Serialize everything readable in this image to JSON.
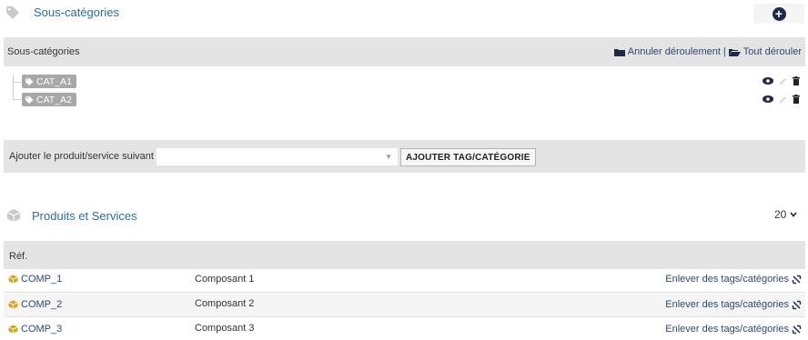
{
  "subcats": {
    "title": "Sous-catégories",
    "header_label": "Sous-catégories",
    "collapse_label": "Annuler déroulement",
    "separator": "|",
    "expand_label": "Tout dérouler",
    "items": [
      {
        "label": "CAT_A1"
      },
      {
        "label": "CAT_A2"
      }
    ]
  },
  "assign": {
    "label": "Ajouter le produit/service suivant",
    "select_value": "",
    "button_label": "AJOUTER TAG/CATÉGORIE"
  },
  "products": {
    "title": "Produits et Services",
    "page_size": "20",
    "header_ref": "Réf.",
    "rows": [
      {
        "ref": "COMP_1",
        "label": "Composant 1",
        "action": "Enlever des tags/catégories"
      },
      {
        "ref": "COMP_2",
        "label": "Composant 2",
        "action": "Enlever des tags/catégories"
      },
      {
        "ref": "COMP_3",
        "label": "Composant 3",
        "action": "Enlever des tags/catégories"
      }
    ]
  },
  "colors": {
    "title_link": "#2c6ea0",
    "band_bg": "#e4e4e4",
    "tag_pill": "#a8a8a8",
    "add_button": "#1f2a44"
  }
}
